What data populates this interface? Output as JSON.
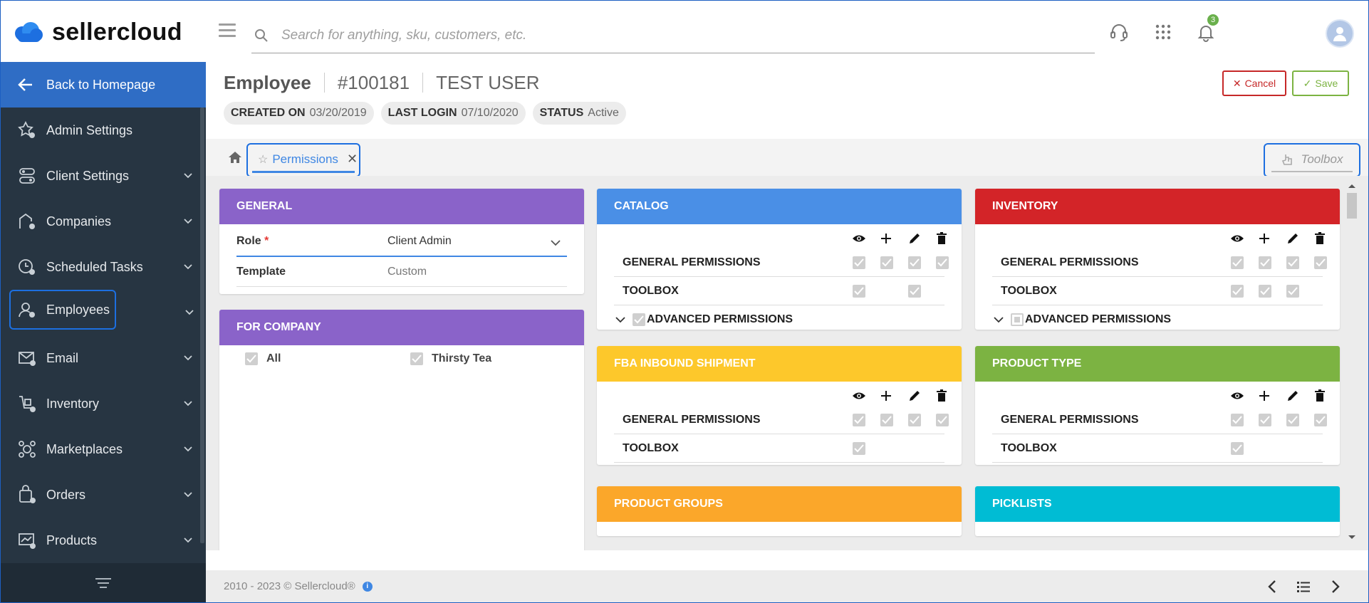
{
  "brand": {
    "name": "sellercloud"
  },
  "search": {
    "placeholder": "Search for anything, sku, customers, etc."
  },
  "notifications": {
    "count": "3"
  },
  "sidebar": {
    "back": "Back to Homepage",
    "items": [
      {
        "label": "Admin Settings",
        "icon": "admin-settings-icon",
        "expandable": false
      },
      {
        "label": "Client Settings",
        "icon": "client-settings-icon",
        "expandable": true
      },
      {
        "label": "Companies",
        "icon": "companies-icon",
        "expandable": true
      },
      {
        "label": "Scheduled Tasks",
        "icon": "scheduled-tasks-icon",
        "expandable": true
      },
      {
        "label": "Employees",
        "icon": "employees-icon",
        "expandable": true,
        "selected": true
      },
      {
        "label": "Email",
        "icon": "email-icon",
        "expandable": true
      },
      {
        "label": "Inventory",
        "icon": "inventory-icon",
        "expandable": true
      },
      {
        "label": "Marketplaces",
        "icon": "marketplaces-icon",
        "expandable": true
      },
      {
        "label": "Orders",
        "icon": "orders-icon",
        "expandable": true
      },
      {
        "label": "Products",
        "icon": "products-icon",
        "expandable": true
      }
    ]
  },
  "header": {
    "title": "Employee",
    "id": "#100181",
    "name": "TEST USER",
    "cancel": "Cancel",
    "save": "Save",
    "chips": [
      {
        "key": "CREATED ON",
        "value": "03/20/2019"
      },
      {
        "key": "LAST LOGIN",
        "value": "07/10/2020"
      },
      {
        "key": "STATUS",
        "value": "Active"
      }
    ]
  },
  "tabs": {
    "active": "Permissions",
    "toolbox": "Toolbox"
  },
  "general": {
    "title": "GENERAL",
    "role_label": "Role",
    "role_value": "Client Admin",
    "template_label": "Template",
    "template_value": "Custom"
  },
  "for_company": {
    "title": "FOR COMPANY",
    "options": [
      "All",
      "Thirsty Tea"
    ]
  },
  "catalog": {
    "title": "CATALOG",
    "rows": [
      "GENERAL PERMISSIONS",
      "TOOLBOX"
    ],
    "advanced": "ADVANCED PERMISSIONS"
  },
  "inventory": {
    "title": "INVENTORY",
    "rows": [
      "GENERAL PERMISSIONS",
      "TOOLBOX"
    ],
    "advanced": "ADVANCED PERMISSIONS"
  },
  "fba": {
    "title": "FBA INBOUND SHIPMENT",
    "rows": [
      "GENERAL PERMISSIONS",
      "TOOLBOX"
    ]
  },
  "product_type": {
    "title": "PRODUCT TYPE",
    "rows": [
      "GENERAL PERMISSIONS",
      "TOOLBOX"
    ]
  },
  "product_groups": {
    "title": "PRODUCT GROUPS"
  },
  "picklists": {
    "title": "PICKLISTS"
  },
  "colors": {
    "purple": "#8a63c9",
    "blue": "#4a8fe6",
    "red": "#d32428",
    "yellow": "#fdc82b",
    "green": "#7cb342",
    "orange": "#fba72a",
    "cyan": "#00bcd4",
    "sidebar": "#273542",
    "accent": "#2f6dc5"
  },
  "footer": {
    "copyright": "2010 - 2023 © Sellercloud®"
  }
}
